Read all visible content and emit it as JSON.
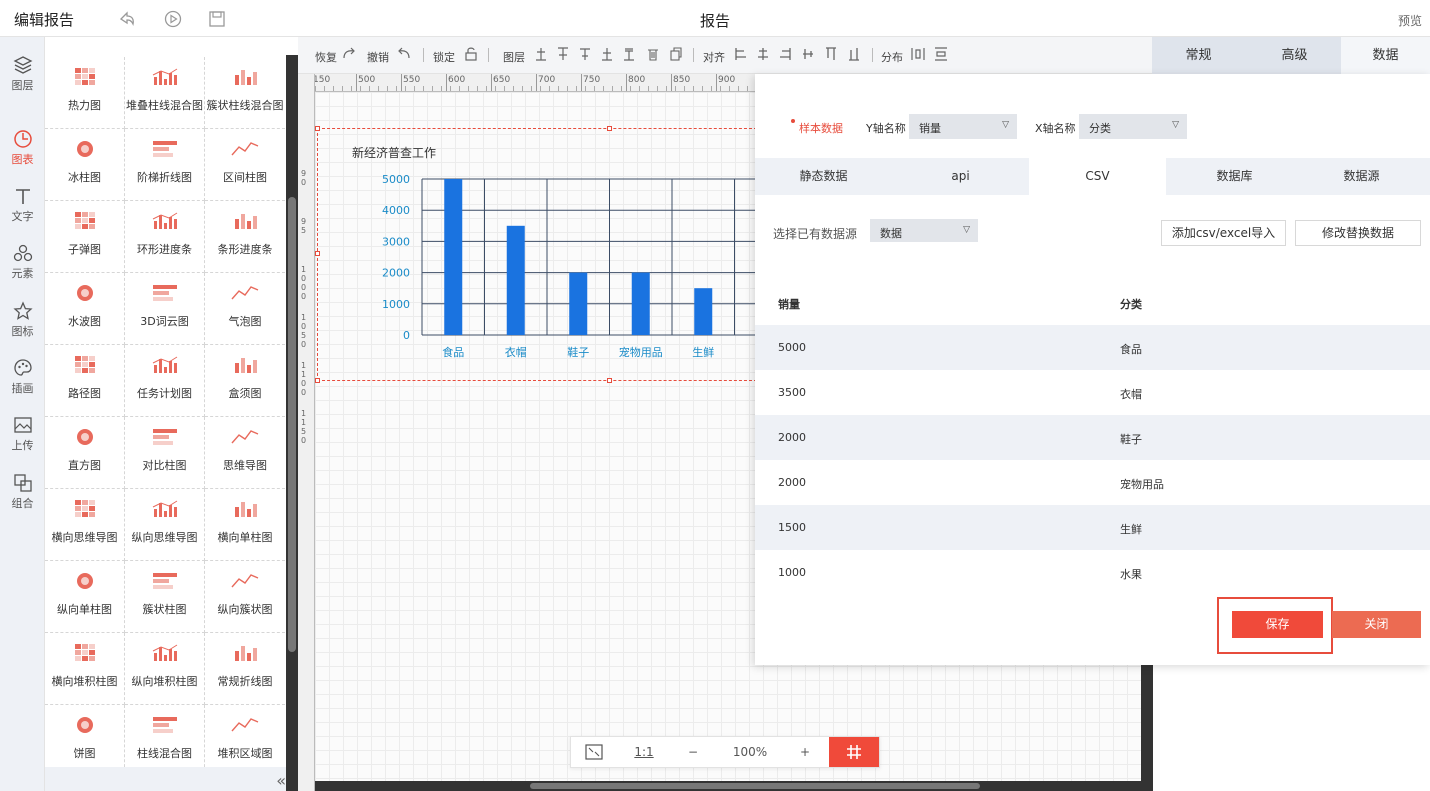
{
  "topbar": {
    "title": "编辑报告",
    "center_title": "报告",
    "preview": "预览"
  },
  "iconbar": [
    {
      "label": "图层",
      "icon": "layers-icon"
    },
    {
      "label": "图表",
      "icon": "chart-clock-icon",
      "active": true
    },
    {
      "label": "文字",
      "icon": "text-icon"
    },
    {
      "label": "元素",
      "icon": "elements-icon"
    },
    {
      "label": "图标",
      "icon": "star-icon"
    },
    {
      "label": "插画",
      "icon": "palette-icon"
    },
    {
      "label": "上传",
      "icon": "upload-image-icon"
    },
    {
      "label": "组合",
      "icon": "group-icon"
    }
  ],
  "components": [
    "热力图",
    "堆叠柱线混合图",
    "簇状柱线混合图",
    "冰柱图",
    "阶梯折线图",
    "区间柱图",
    "子弹图",
    "环形进度条",
    "条形进度条",
    "水波图",
    "3D词云图",
    "气泡图",
    "路径图",
    "任务计划图",
    "盒须图",
    "直方图",
    "对比柱图",
    "思维导图",
    "横向思维导图",
    "纵向思维导图",
    "横向单柱图",
    "纵向单柱图",
    "簇状柱图",
    "纵向簇状图",
    "横向堆积柱图",
    "纵向堆积柱图",
    "常规折线图",
    "饼图",
    "柱线混合图",
    "堆积区域图"
  ],
  "toolbar": {
    "redo": "恢复",
    "undo": "撤销",
    "lock": "锁定",
    "layer": "图层",
    "align": "对齐",
    "distribute": "分布"
  },
  "ruler_labels": [
    "150",
    "500",
    "550",
    "600",
    "650",
    "700",
    "750",
    "800",
    "850",
    "900"
  ],
  "ruler_v_labels": [
    "9 0",
    "9 5",
    "1 0 0 0",
    "1 0 5 0",
    "1 1 0 0",
    "1 1 5 0"
  ],
  "chart_data": {
    "type": "bar",
    "title": "新经济普查工作",
    "categories": [
      "食品",
      "衣帽",
      "鞋子",
      "宠物用品",
      "生鲜"
    ],
    "values": [
      5000,
      3500,
      2000,
      2000,
      1500
    ],
    "yticks": [
      0,
      1000,
      2000,
      3000,
      4000,
      5000
    ],
    "ylim": [
      0,
      5000
    ],
    "color": "#1a73e0",
    "grid": true
  },
  "zoom": {
    "fit_icon": "fit-screen-icon",
    "ratio": "1:1",
    "minus": "−",
    "value": "100%",
    "plus": "+"
  },
  "right_tabs": [
    "常规",
    "高级",
    "数据"
  ],
  "dialog": {
    "sample": "样本数据",
    "y_label": "Y轴名称",
    "y_value": "销量",
    "x_label": "X轴名称",
    "x_value": "分类",
    "tabs": [
      "静态数据",
      "api",
      "CSV",
      "数据库",
      "数据源"
    ],
    "source_label": "选择已有数据源",
    "source_value": "数据",
    "import_btn": "添加csv/excel导入",
    "modify_btn": "修改替换数据",
    "columns": [
      "销量",
      "分类"
    ],
    "rows": [
      [
        "5000",
        "食品"
      ],
      [
        "3500",
        "衣帽"
      ],
      [
        "2000",
        "鞋子"
      ],
      [
        "2000",
        "宠物用品"
      ],
      [
        "1500",
        "生鲜"
      ],
      [
        "1000",
        "水果"
      ]
    ],
    "save": "保存",
    "close": "关闭"
  },
  "colors": {
    "accent": "#f04a3a",
    "bar": "#1a73e0",
    "axis_text": "#1a8bc8"
  }
}
